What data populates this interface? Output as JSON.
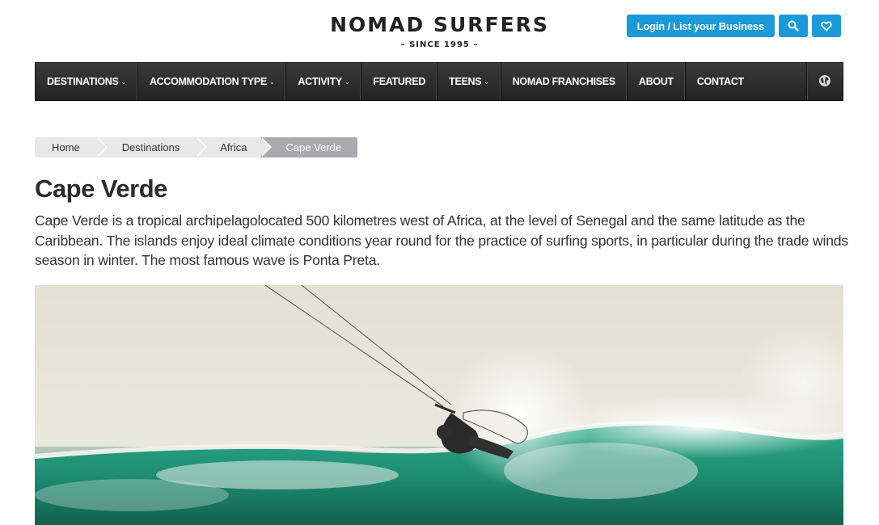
{
  "brand": {
    "title": "NOMAD SURFERS",
    "tagline": "– SINCE 1995 –"
  },
  "header": {
    "login_label": "Login / List your Business",
    "search_icon": "search-icon",
    "favorites_icon": "heart-icon",
    "accent_color": "#1a9ad9"
  },
  "nav": {
    "items": [
      {
        "label": "DESTINATIONS",
        "has_dropdown": true
      },
      {
        "label": "ACCOMMODATION TYPE",
        "has_dropdown": true
      },
      {
        "label": "ACTIVITY",
        "has_dropdown": true
      },
      {
        "label": "FEATURED",
        "has_dropdown": false
      },
      {
        "label": "TEENS",
        "has_dropdown": true
      },
      {
        "label": "NOMAD FRANCHISES",
        "has_dropdown": false
      },
      {
        "label": "ABOUT",
        "has_dropdown": false
      },
      {
        "label": "CONTACT",
        "has_dropdown": false
      }
    ],
    "language_icon": "globe-icon"
  },
  "breadcrumb": [
    "Home",
    "Destinations",
    "Africa",
    "Cape Verde"
  ],
  "page": {
    "title": "Cape Verde",
    "intro": "Cape Verde is a tropical archipelagolocated 500 kilometres west of Africa, at the level of Senegal and the same latitude as the Caribbean. The islands enjoy ideal climate conditions year round for the practice of surfing sports, in particular during the trade winds season in winter. The most famous wave is Ponta Preta."
  },
  "hero": {
    "image_subject": "kitesurfer jumping over a breaking turquoise wave"
  }
}
